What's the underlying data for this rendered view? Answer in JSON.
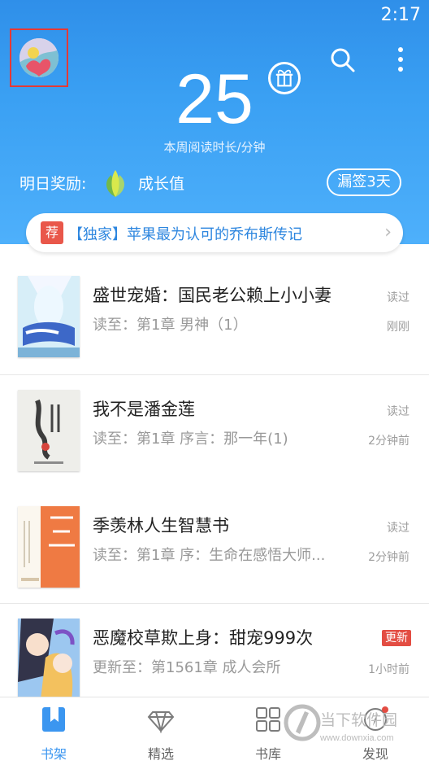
{
  "status": {
    "time": "2:17"
  },
  "header": {
    "weekly_minutes": "25",
    "weekly_label": "本周阅读时长/分钟",
    "reward_label": "明日奖励:",
    "growth_label": "成长值",
    "missed_label": "漏签3天"
  },
  "recommend": {
    "badge": "荐",
    "text": "【独家】苹果最为认可的乔布斯传记"
  },
  "books": [
    {
      "title": "盛世宠婚：国民老公赖上小小妻",
      "progress": "读至：第1章 男神（1）",
      "tag": "读过",
      "time": "刚刚"
    },
    {
      "title": "我不是潘金莲",
      "progress": "读至：第1章 序言：那一年(1)",
      "tag": "读过",
      "time": "2分钟前"
    },
    {
      "title": "季羡林人生智慧书",
      "progress": "读至：第1章 序：生命在感悟大师...",
      "tag": "读过",
      "time": "2分钟前"
    },
    {
      "title": "恶魔校草欺上身：甜宠999次",
      "progress": "更新至：第1561章 成人会所",
      "tag": "更新",
      "time": "1小时前"
    }
  ],
  "tabs": [
    {
      "label": "书架",
      "icon": "bookmark-book-icon"
    },
    {
      "label": "精选",
      "icon": "diamond-icon"
    },
    {
      "label": "书库",
      "icon": "grid-icon"
    },
    {
      "label": "发现",
      "icon": "compass-icon"
    }
  ],
  "watermark": {
    "brand": "当下软件园",
    "url": "www.downxia.com"
  },
  "colors": {
    "accent": "#3b96f0",
    "header": "#3aa0f3",
    "new_badge": "#e34d43",
    "recommend_badge": "#e9574a"
  }
}
